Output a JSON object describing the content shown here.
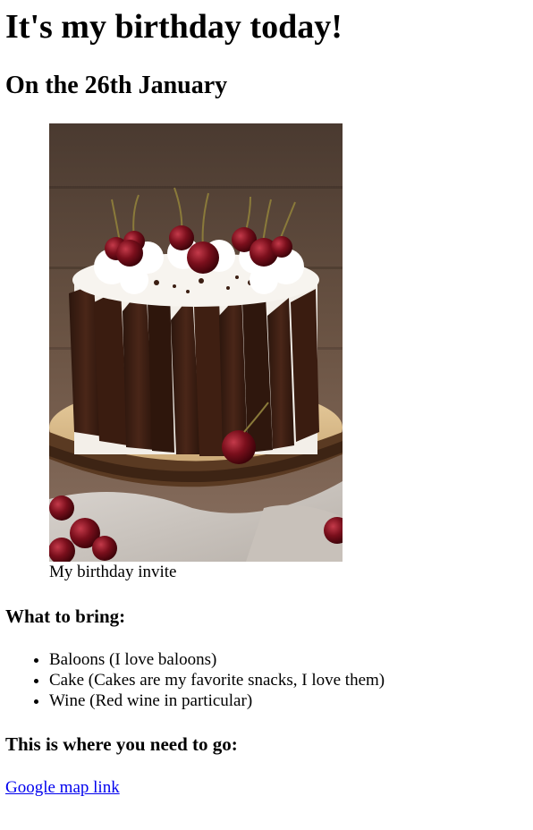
{
  "page": {
    "title": "It's my birthday today!",
    "date_heading": "On the 26th January"
  },
  "figure": {
    "image": "cake-photo",
    "caption": "My birthday invite"
  },
  "bring": {
    "heading": "What to bring:",
    "items": [
      "Baloons (I love baloons)",
      "Cake (Cakes are my favorite snacks, I love them)",
      "Wine (Red wine in particular)"
    ]
  },
  "location": {
    "heading": "This is where you need to go:",
    "link_text": "Google map link"
  },
  "colors": {
    "link": "#0000ee",
    "text": "#000000",
    "background": "#ffffff"
  }
}
